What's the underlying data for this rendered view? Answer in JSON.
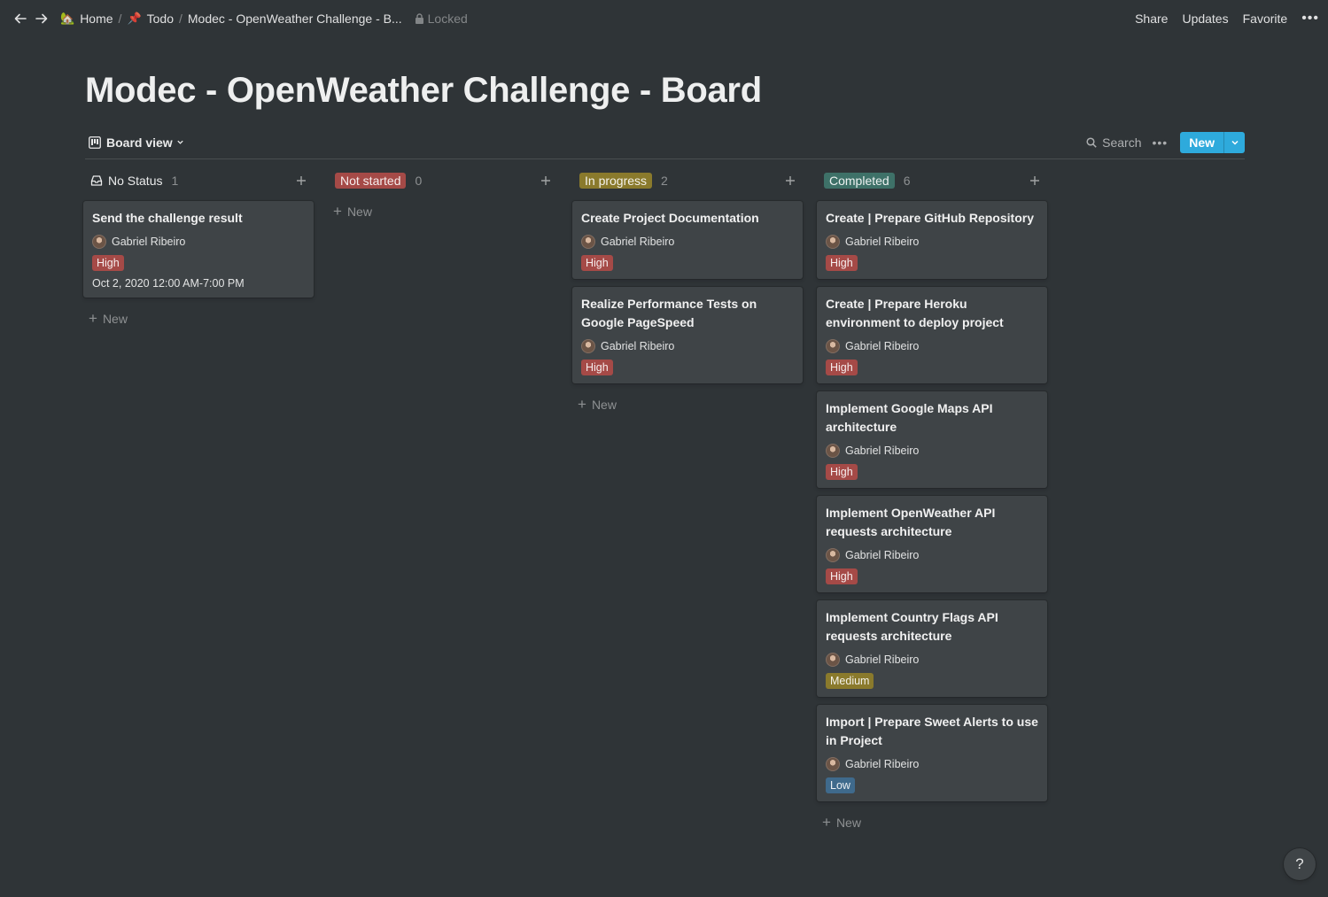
{
  "breadcrumb": {
    "items": [
      {
        "emoji": "🏡",
        "label": "Home"
      },
      {
        "emoji": "📌",
        "label": "Todo"
      },
      {
        "emoji": "",
        "label": "Modec - OpenWeather Challenge - B..."
      }
    ],
    "locked_label": "Locked"
  },
  "topbar": {
    "share": "Share",
    "updates": "Updates",
    "favorite": "Favorite",
    "more": "•••"
  },
  "page": {
    "title": "Modec - OpenWeather Challenge - Board"
  },
  "viewbar": {
    "view_label": "Board view",
    "search_label": "Search",
    "more": "•••",
    "new_label": "New"
  },
  "colors": {
    "accent": "#2eaadc",
    "not_started": "#a54a47",
    "in_progress": "#8a7a2c",
    "completed": "#3e7168",
    "tag_high": "#a54a47",
    "tag_medium": "#8a7a2c",
    "tag_low": "#3f6a8c"
  },
  "board": {
    "new_label": "New",
    "columns": [
      {
        "label": "No Status",
        "count": "1",
        "style": "plain",
        "color": "",
        "cards": [
          {
            "title": "Send the challenge result",
            "person": "Gabriel Ribeiro",
            "tag": "High",
            "tag_color": "#a54a47",
            "date": "Oct 2, 2020 12:00 AM-7:00 PM"
          }
        ]
      },
      {
        "label": "Not started",
        "count": "0",
        "style": "pill",
        "color": "#a54a47",
        "cards": []
      },
      {
        "label": "In progress",
        "count": "2",
        "style": "pill",
        "color": "#8a7a2c",
        "cards": [
          {
            "title": "Create Project Documentation",
            "person": "Gabriel Ribeiro",
            "tag": "High",
            "tag_color": "#a54a47"
          },
          {
            "title": "Realize Performance Tests on Google PageSpeed",
            "person": "Gabriel Ribeiro",
            "tag": "High",
            "tag_color": "#a54a47"
          }
        ]
      },
      {
        "label": "Completed",
        "count": "6",
        "style": "pill",
        "color": "#3e7168",
        "cards": [
          {
            "title": "Create | Prepare GitHub Repository",
            "person": "Gabriel Ribeiro",
            "tag": "High",
            "tag_color": "#a54a47"
          },
          {
            "title": "Create | Prepare Heroku environment to deploy project",
            "person": "Gabriel Ribeiro",
            "tag": "High",
            "tag_color": "#a54a47"
          },
          {
            "title": "Implement Google Maps API architecture",
            "person": "Gabriel Ribeiro",
            "tag": "High",
            "tag_color": "#a54a47"
          },
          {
            "title": "Implement OpenWeather API requests architecture",
            "person": "Gabriel Ribeiro",
            "tag": "High",
            "tag_color": "#a54a47"
          },
          {
            "title": "Implement Country Flags API requests architecture",
            "person": "Gabriel Ribeiro",
            "tag": "Medium",
            "tag_color": "#8a7a2c"
          },
          {
            "title": "Import | Prepare Sweet Alerts to use in Project",
            "person": "Gabriel Ribeiro",
            "tag": "Low",
            "tag_color": "#3f6a8c"
          }
        ]
      }
    ]
  },
  "help": {
    "label": "?"
  }
}
